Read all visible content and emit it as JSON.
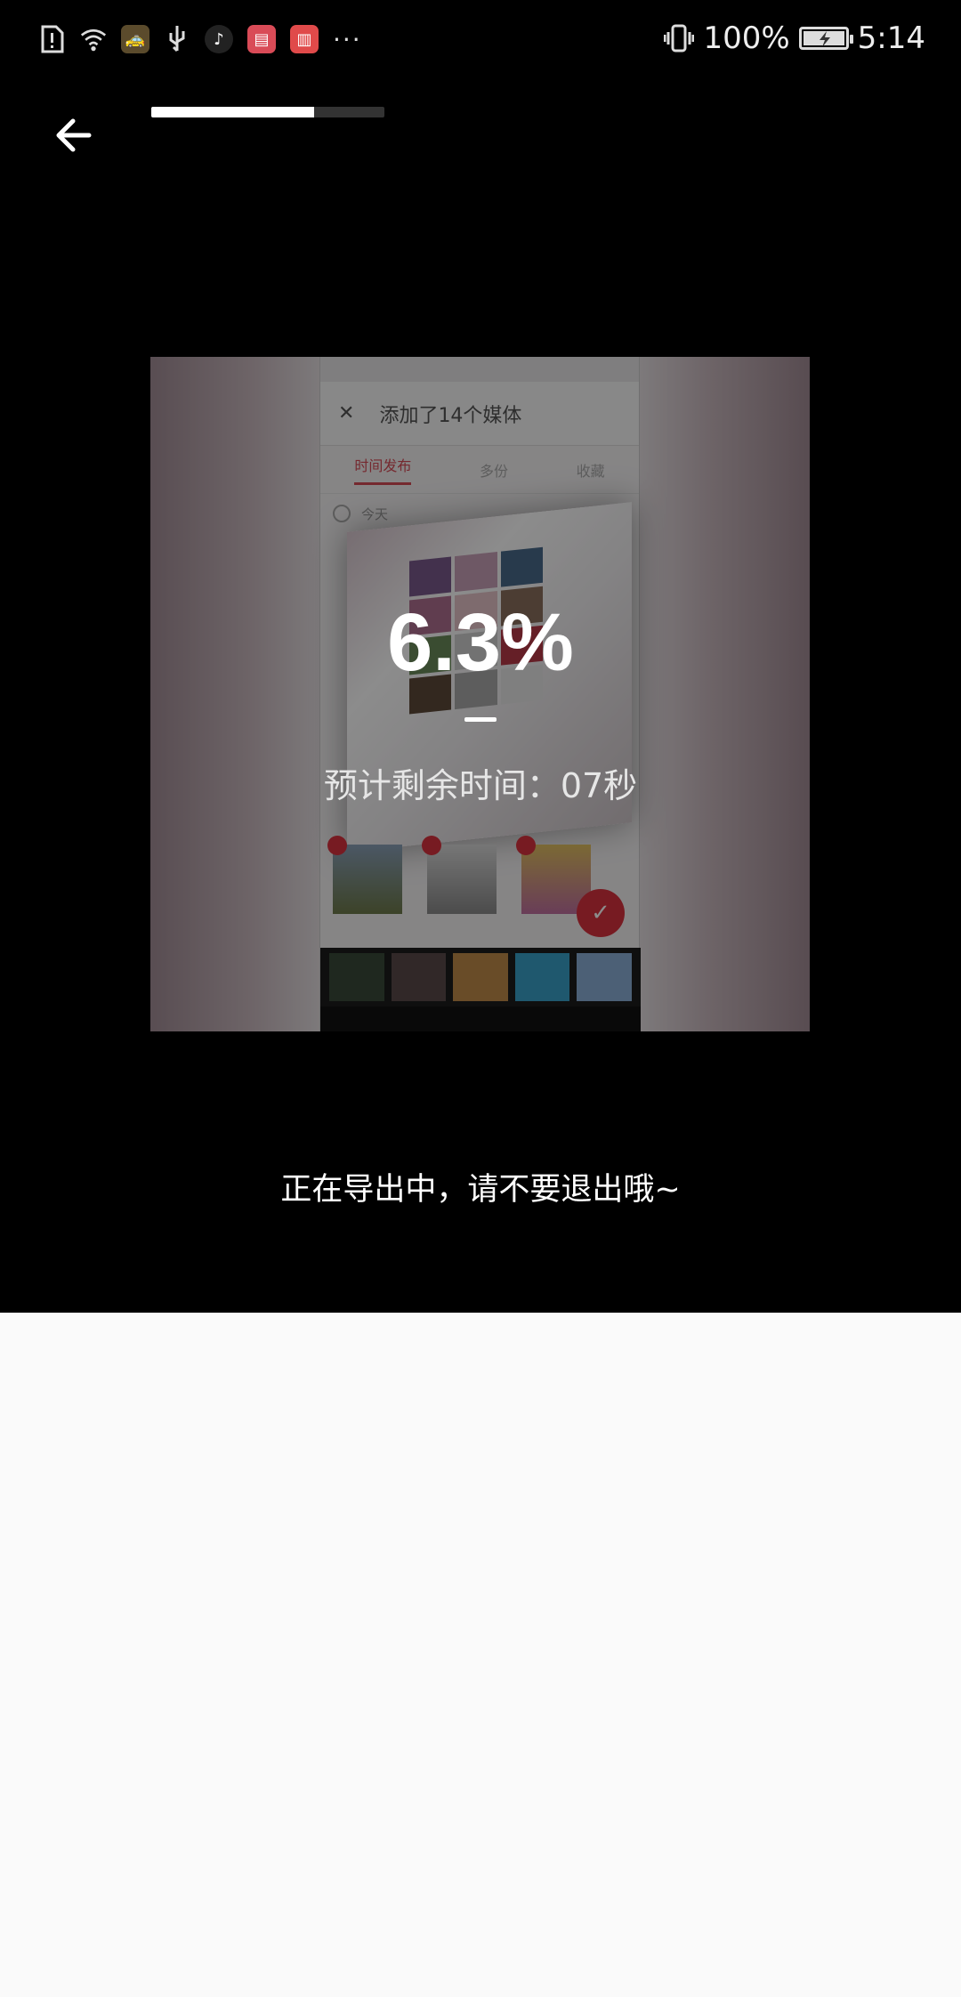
{
  "status_bar": {
    "battery_percent": "100%",
    "time": "5:14",
    "battery_level": 1.0,
    "icons": [
      "alert-icon",
      "wifi-icon",
      "app-icon",
      "usb-icon",
      "tiktok-icon",
      "shop-icon",
      "book-icon",
      "more-icon",
      "vibrate-icon",
      "battery-icon"
    ],
    "more": "···"
  },
  "header": {
    "progress_fraction": 0.063
  },
  "export": {
    "percent": "6.3%",
    "remaining_label": "预计剩余时间：",
    "remaining_value": "07秒",
    "note": "正在导出中，请不要退出哦~"
  },
  "preview": {
    "phone_header_title": "添加了14个媒体",
    "phone_header_close": "✕",
    "tabs": [
      "时间发布",
      "多份",
      "收藏"
    ],
    "row_label": "今天"
  },
  "colors": {
    "background": "#000000",
    "accent_red": "#d9323e",
    "bottom_panel": "#fafafa"
  }
}
